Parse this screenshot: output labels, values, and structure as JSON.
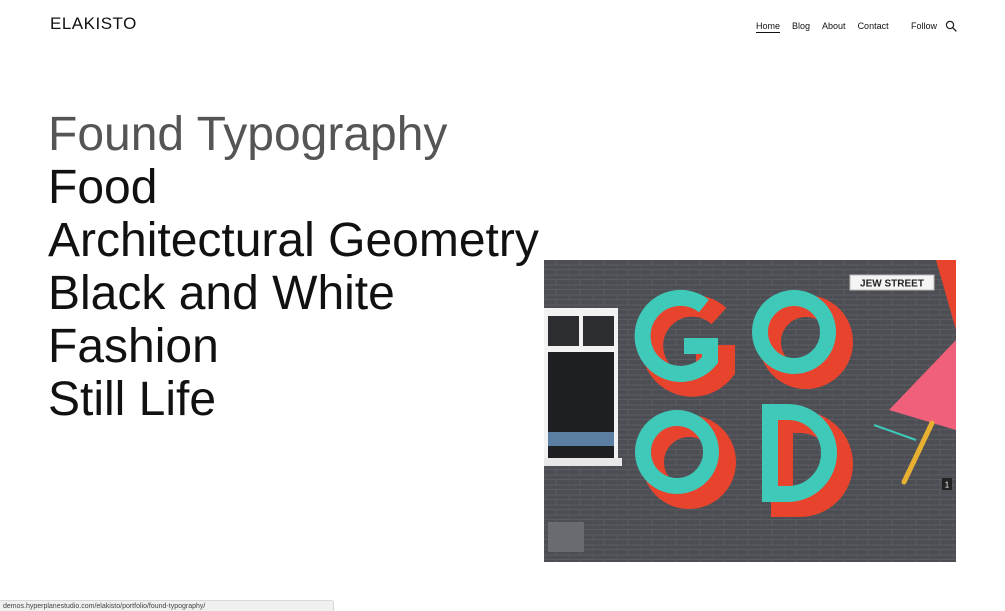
{
  "header": {
    "logo": "ELAKISTO",
    "nav": [
      {
        "label": "Home",
        "active": true
      },
      {
        "label": "Blog",
        "active": false
      },
      {
        "label": "About",
        "active": false
      },
      {
        "label": "Contact",
        "active": false
      }
    ],
    "follow_label": "Follow",
    "search_icon": "search-icon"
  },
  "portfolio": {
    "items": [
      {
        "label": "Found Typography",
        "hovered": true
      },
      {
        "label": "Food",
        "hovered": false
      },
      {
        "label": "Architectural Geometry",
        "hovered": false
      },
      {
        "label": "Black and White",
        "hovered": false
      },
      {
        "label": "Fashion",
        "hovered": false
      },
      {
        "label": "Still Life",
        "hovered": false
      }
    ]
  },
  "featured_image": {
    "street_sign": "JEW STREET",
    "mural_text": "GOOD",
    "door_number": "1",
    "colors": {
      "wall": "#4d4e53",
      "teal": "#3fc9b8",
      "red": "#e8432c",
      "pink": "#f0607a",
      "yellow": "#e8b030"
    }
  },
  "statusbar": {
    "url": "demos.hyperplanestudio.com/elakisto/portfolio/found-typography/"
  }
}
